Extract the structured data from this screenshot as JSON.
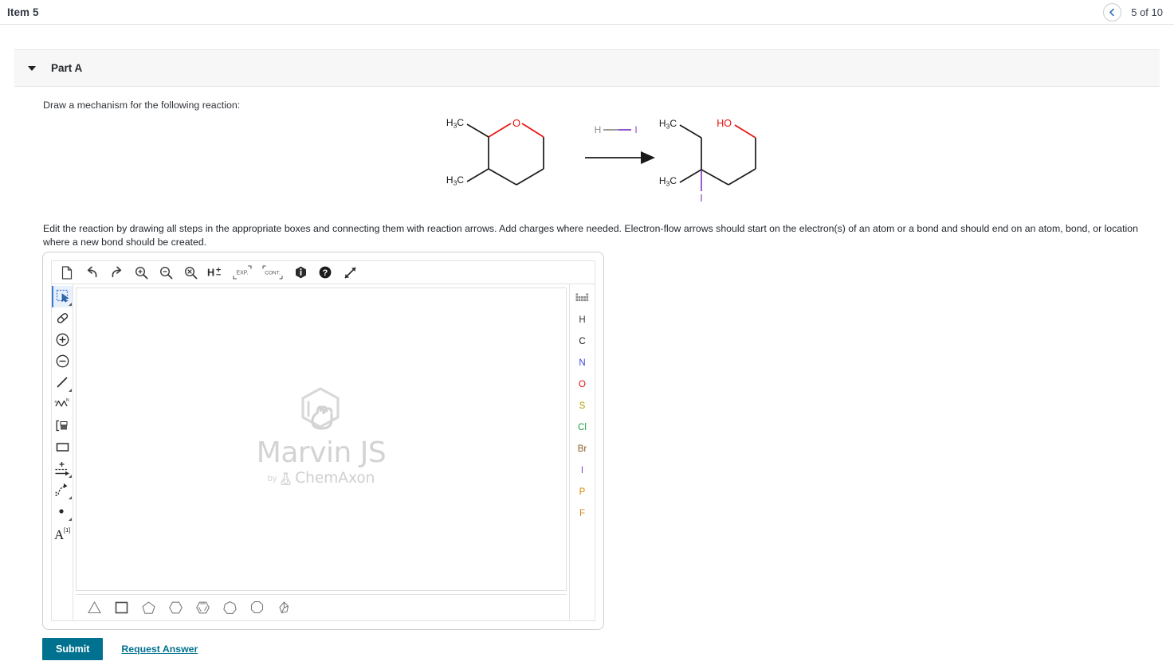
{
  "header": {
    "item_title": "Item 5",
    "progress": "5 of 10",
    "prev_icon": "chevron-left-icon"
  },
  "part": {
    "label": "Part A",
    "collapse_icon": "caret-down-icon",
    "prompt": "Draw a mechanism for the following reaction:",
    "instructions": "Edit the reaction by drawing all steps in the appropriate boxes and connecting them with reaction arrows. Add charges where needed. Electron-flow arrows should start on the electron(s) of an atom or a bond and should end on an atom, bond, or location where a new bond should be created."
  },
  "reaction": {
    "reactant_labels": [
      "H3C",
      "H3C",
      "O"
    ],
    "reagent_labels": [
      "H",
      "I"
    ],
    "product_labels": [
      "H3C",
      "H3C",
      "HO",
      "I"
    ],
    "oxygen_color": "#e8120c",
    "iodine_color": "#8b3fc4",
    "hydrogen_color": "#8d8d8d",
    "bond_color": "#1a1a1a"
  },
  "editor": {
    "top_tools": [
      {
        "name": "new-document-icon",
        "title": "Clear"
      },
      {
        "name": "undo-icon",
        "title": "Undo"
      },
      {
        "name": "redo-icon",
        "title": "Redo"
      },
      {
        "name": "zoom-in-icon",
        "title": "Zoom in"
      },
      {
        "name": "zoom-out-icon",
        "title": "Zoom out"
      },
      {
        "name": "zoom-reset-icon",
        "title": "Reset zoom"
      },
      {
        "name": "hydrogen-toggle-icon",
        "title": "Add/Remove explicit hydrogens",
        "label": "H±"
      },
      {
        "name": "expand-icon",
        "title": "Expand group",
        "label": "EXP."
      },
      {
        "name": "contract-icon",
        "title": "Contract group",
        "label": "CONT."
      },
      {
        "name": "info-icon",
        "title": "Information"
      },
      {
        "name": "help-icon",
        "title": "Help"
      },
      {
        "name": "fullscreen-icon",
        "title": "Fullscreen"
      }
    ],
    "left_tools": [
      {
        "name": "selection-tool-icon",
        "title": "Selection",
        "active": true,
        "has_corner": true
      },
      {
        "name": "eraser-tool-icon",
        "title": "Eraser",
        "active": false,
        "has_corner": false
      },
      {
        "name": "increase-charge-icon",
        "title": "Increase charge",
        "active": false,
        "has_corner": false
      },
      {
        "name": "decrease-charge-icon",
        "title": "Decrease charge",
        "active": false,
        "has_corner": false
      },
      {
        "name": "single-bond-tool-icon",
        "title": "Single bond",
        "active": false,
        "has_corner": true
      },
      {
        "name": "chain-tool-icon",
        "title": "Chain",
        "active": false,
        "has_corner": false
      },
      {
        "name": "bracket-tool-icon",
        "title": "Brackets",
        "active": false,
        "has_corner": false
      },
      {
        "name": "rectangle-tool-icon",
        "title": "Rectangle",
        "active": false,
        "has_corner": false
      },
      {
        "name": "reaction-arrow-tool-icon",
        "title": "Reaction arrow",
        "active": false,
        "has_corner": true
      },
      {
        "name": "electron-flow-arrow-tool-icon",
        "title": "Electron flow arrow",
        "active": false,
        "has_corner": true
      },
      {
        "name": "lone-pair-tool-icon",
        "title": "Lone pair / radical",
        "active": false,
        "has_corner": true
      },
      {
        "name": "atom-label-tool-icon",
        "title": "Atom label",
        "active": false,
        "has_corner": false,
        "label": "A"
      }
    ],
    "bottom_templates": [
      {
        "name": "cyclopropane-template-icon",
        "sides": 3,
        "aromatic": false
      },
      {
        "name": "cyclobutane-template-icon",
        "sides": 4,
        "aromatic": false
      },
      {
        "name": "cyclopentane-template-icon",
        "sides": 5,
        "aromatic": false
      },
      {
        "name": "cyclohexane-template-icon",
        "sides": 6,
        "aromatic": false
      },
      {
        "name": "benzene-template-icon",
        "sides": 6,
        "aromatic": true
      },
      {
        "name": "cycloheptane-template-icon",
        "sides": 7,
        "aromatic": false
      },
      {
        "name": "cyclooctane-template-icon",
        "sides": 8,
        "aromatic": false
      },
      {
        "name": "bicyclic-template-icon",
        "sides": 0,
        "aromatic": false
      }
    ],
    "palette": [
      {
        "symbol": "",
        "name": "periodic-table-icon",
        "color": "#666666"
      },
      {
        "symbol": "H",
        "name": "element-h",
        "color": "#3b3b3b"
      },
      {
        "symbol": "C",
        "name": "element-c",
        "color": "#1a1a1a"
      },
      {
        "symbol": "N",
        "name": "element-n",
        "color": "#3d48d8"
      },
      {
        "symbol": "O",
        "name": "element-o",
        "color": "#e8120c"
      },
      {
        "symbol": "S",
        "name": "element-s",
        "color": "#b3a000"
      },
      {
        "symbol": "Cl",
        "name": "element-cl",
        "color": "#1f9e3e"
      },
      {
        "symbol": "Br",
        "name": "element-br",
        "color": "#8a5a28"
      },
      {
        "symbol": "I",
        "name": "element-i",
        "color": "#8b3fc4"
      },
      {
        "symbol": "P",
        "name": "element-p",
        "color": "#d98b00"
      },
      {
        "symbol": "F",
        "name": "element-f",
        "color": "#c98a1a"
      }
    ],
    "watermark": {
      "title": "Marvin JS",
      "by": "by",
      "vendor": "ChemAxon"
    }
  },
  "footer": {
    "submit_label": "Submit",
    "request_label": "Request Answer"
  },
  "colors": {
    "accent": "#00718f",
    "panel_bg": "#f7f7f7"
  }
}
